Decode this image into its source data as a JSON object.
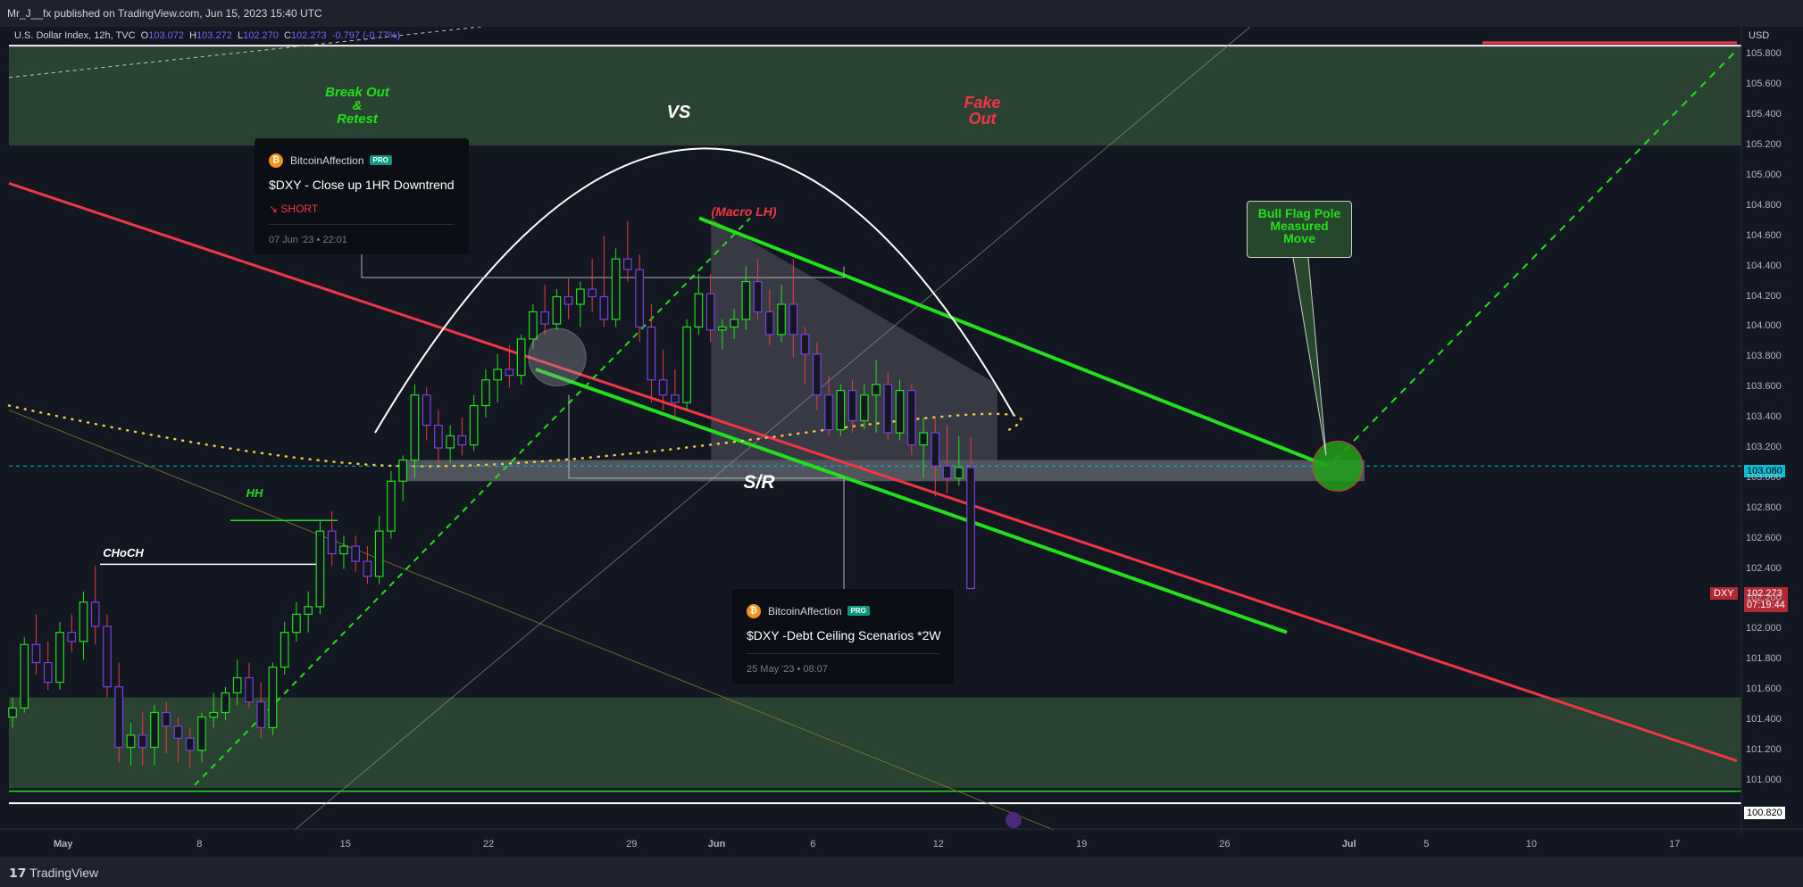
{
  "header": {
    "published": "Mr_J__fx published on TradingView.com, Jun 15, 2023 15:40 UTC"
  },
  "legend": {
    "symbol": "U.S. Dollar Index, 12h, TVC",
    "o_label": "O",
    "o": "103.072",
    "h_label": "H",
    "h": "103.272",
    "l_label": "L",
    "l": "102.270",
    "c_label": "C",
    "c": "102.273",
    "change": "-0.797 (-0.77%)"
  },
  "colors": {
    "background": "#131722",
    "zone_green": "#2e4a35",
    "sr_band": "#9aa0a6",
    "red_line": "#f23645",
    "green_line": "#22e01a",
    "annotation_red": "#f23645",
    "annotation_green": "#22e01a",
    "price_tag_cyan": "#00bcd4",
    "price_tag_red": "#b22833",
    "candle_up": "#22e01a",
    "candle_down": "#7b3fe4"
  },
  "annotations": {
    "breakout": [
      "Break Out",
      "&",
      "Retest"
    ],
    "vs": "VS",
    "fakeout": [
      "Fake",
      "Out"
    ],
    "macro_lh": "(Macro LH)",
    "hh": "HH",
    "choch": "CHoCH",
    "sr": "S/R",
    "bull_flag": [
      "Bull Flag Pole",
      "Measured",
      "Move"
    ]
  },
  "ideas": [
    {
      "author": "BitcoinAffection",
      "badge": "PRO",
      "title": "$DXY - Close up 1HR Downtrend",
      "direction": "SHORT",
      "date": "07 Jun '23 • 22:01"
    },
    {
      "author": "BitcoinAffection",
      "badge": "PRO",
      "title": "$DXY -Debt Ceiling Scenarios *2W",
      "date": "25 May '23 • 08:07"
    }
  ],
  "price_axis": {
    "currency": "USD",
    "current_price": "103.080",
    "symbol_tag": "DXY",
    "last_price": "102.273",
    "countdown": "07:19:44",
    "bottom_price": "100.820"
  },
  "footer": {
    "brand": "TradingView"
  },
  "chart_data": {
    "type": "candlestick",
    "title": "U.S. Dollar Index, 12h, TVC",
    "ylim": [
      100.78,
      105.95
    ],
    "y_ticks": [
      "105.800",
      "105.600",
      "105.400",
      "105.200",
      "105.000",
      "104.800",
      "104.600",
      "104.400",
      "104.200",
      "104.000",
      "103.800",
      "103.600",
      "103.400",
      "103.200",
      "103.000",
      "102.800",
      "102.600",
      "102.400",
      "102.200",
      "102.000",
      "101.800",
      "101.600",
      "101.400",
      "101.200",
      "101.000"
    ],
    "x_ticks": [
      {
        "day": 0,
        "label": "May"
      },
      {
        "day": 7,
        "label": "8"
      },
      {
        "day": 14,
        "label": "15"
      },
      {
        "day": 21,
        "label": "22"
      },
      {
        "day": 28,
        "label": "29"
      },
      {
        "day": 32,
        "label": "Jun"
      },
      {
        "day": 37,
        "label": "6"
      },
      {
        "day": 43,
        "label": "12"
      },
      {
        "day": 50,
        "label": "19"
      },
      {
        "day": 57,
        "label": "26"
      },
      {
        "day": 63,
        "label": "Jul"
      },
      {
        "day": 67,
        "label": "5"
      },
      {
        "day": 72,
        "label": "10"
      },
      {
        "day": 79,
        "label": "17"
      }
    ],
    "candles": [
      [
        101.42,
        101.55,
        101.35,
        101.48
      ],
      [
        101.48,
        101.95,
        101.45,
        101.9
      ],
      [
        101.9,
        102.1,
        101.7,
        101.78
      ],
      [
        101.78,
        101.92,
        101.6,
        101.65
      ],
      [
        101.65,
        102.05,
        101.6,
        101.98
      ],
      [
        101.98,
        102.1,
        101.85,
        101.92
      ],
      [
        101.92,
        102.25,
        101.8,
        102.18
      ],
      [
        102.18,
        102.42,
        101.9,
        102.02
      ],
      [
        102.02,
        102.1,
        101.55,
        101.62
      ],
      [
        101.62,
        101.78,
        101.12,
        101.22
      ],
      [
        101.22,
        101.38,
        101.1,
        101.3
      ],
      [
        101.3,
        101.45,
        101.1,
        101.22
      ],
      [
        101.22,
        101.5,
        101.1,
        101.45
      ],
      [
        101.45,
        101.52,
        101.18,
        101.36
      ],
      [
        101.36,
        101.42,
        101.12,
        101.28
      ],
      [
        101.28,
        101.35,
        101.08,
        101.2
      ],
      [
        101.2,
        101.45,
        101.12,
        101.42
      ],
      [
        101.42,
        101.58,
        101.35,
        101.45
      ],
      [
        101.45,
        101.62,
        101.4,
        101.58
      ],
      [
        101.58,
        101.8,
        101.5,
        101.68
      ],
      [
        101.68,
        101.78,
        101.48,
        101.52
      ],
      [
        101.52,
        101.65,
        101.28,
        101.35
      ],
      [
        101.35,
        101.78,
        101.3,
        101.75
      ],
      [
        101.75,
        102.05,
        101.7,
        101.98
      ],
      [
        101.98,
        102.18,
        101.92,
        102.1
      ],
      [
        102.1,
        102.25,
        101.98,
        102.15
      ],
      [
        102.15,
        102.72,
        102.1,
        102.65
      ],
      [
        102.65,
        102.78,
        102.42,
        102.5
      ],
      [
        102.5,
        102.62,
        102.4,
        102.55
      ],
      [
        102.55,
        102.62,
        102.38,
        102.45
      ],
      [
        102.45,
        102.55,
        102.3,
        102.35
      ],
      [
        102.35,
        102.75,
        102.3,
        102.65
      ],
      [
        102.65,
        103.05,
        102.6,
        102.98
      ],
      [
        102.98,
        103.15,
        102.85,
        103.12
      ],
      [
        103.12,
        103.62,
        103.0,
        103.55
      ],
      [
        103.55,
        103.6,
        103.25,
        103.35
      ],
      [
        103.35,
        103.45,
        103.1,
        103.2
      ],
      [
        103.2,
        103.35,
        103.1,
        103.28
      ],
      [
        103.28,
        103.4,
        103.15,
        103.22
      ],
      [
        103.22,
        103.55,
        103.18,
        103.48
      ],
      [
        103.48,
        103.72,
        103.4,
        103.65
      ],
      [
        103.65,
        103.82,
        103.5,
        103.72
      ],
      [
        103.72,
        103.88,
        103.6,
        103.68
      ],
      [
        103.68,
        103.95,
        103.62,
        103.92
      ],
      [
        103.92,
        104.15,
        103.85,
        104.1
      ],
      [
        104.1,
        104.28,
        103.95,
        104.02
      ],
      [
        104.02,
        104.25,
        103.98,
        104.2
      ],
      [
        104.2,
        104.32,
        104.05,
        104.15
      ],
      [
        104.15,
        104.3,
        104.0,
        104.25
      ],
      [
        104.25,
        104.45,
        104.1,
        104.2
      ],
      [
        104.2,
        104.6,
        104.0,
        104.05
      ],
      [
        104.05,
        104.52,
        104.0,
        104.45
      ],
      [
        104.45,
        104.7,
        104.3,
        104.38
      ],
      [
        104.38,
        104.48,
        103.9,
        104.0
      ],
      [
        104.0,
        104.15,
        103.5,
        103.65
      ],
      [
        103.65,
        103.85,
        103.45,
        103.55
      ],
      [
        103.55,
        103.72,
        103.4,
        103.5
      ],
      [
        103.5,
        104.05,
        103.45,
        104.0
      ],
      [
        104.0,
        104.35,
        103.95,
        104.22
      ],
      [
        104.22,
        104.35,
        103.9,
        103.98
      ],
      [
        103.98,
        104.05,
        103.85,
        104.0
      ],
      [
        104.0,
        104.12,
        103.92,
        104.05
      ],
      [
        104.05,
        104.4,
        103.98,
        104.3
      ],
      [
        104.3,
        104.45,
        104.05,
        104.1
      ],
      [
        104.1,
        104.25,
        103.88,
        103.95
      ],
      [
        103.95,
        104.28,
        103.9,
        104.15
      ],
      [
        104.15,
        104.45,
        103.8,
        103.95
      ],
      [
        103.95,
        104.0,
        103.62,
        103.82
      ],
      [
        103.82,
        103.9,
        103.45,
        103.55
      ],
      [
        103.55,
        103.68,
        103.28,
        103.32
      ],
      [
        103.32,
        103.62,
        103.28,
        103.58
      ],
      [
        103.58,
        103.65,
        103.3,
        103.38
      ],
      [
        103.38,
        103.62,
        103.32,
        103.55
      ],
      [
        103.55,
        103.78,
        103.3,
        103.62
      ],
      [
        103.62,
        103.7,
        103.25,
        103.3
      ],
      [
        103.3,
        103.65,
        103.25,
        103.58
      ],
      [
        103.58,
        103.62,
        103.15,
        103.22
      ],
      [
        103.22,
        103.4,
        103.0,
        103.3
      ],
      [
        103.3,
        103.4,
        102.88,
        103.08
      ],
      [
        103.08,
        103.35,
        102.9,
        103.0
      ],
      [
        103.0,
        103.28,
        102.95,
        103.07
      ],
      [
        103.07,
        103.27,
        102.27,
        102.27
      ]
    ],
    "levels": {
      "sr_zone": [
        102.98,
        103.12
      ],
      "upper_zone": [
        105.2,
        105.85
      ],
      "lower_zone": [
        100.95,
        101.55
      ],
      "current_price_line": 103.08,
      "choch": 102.43,
      "hh": 102.72
    }
  }
}
